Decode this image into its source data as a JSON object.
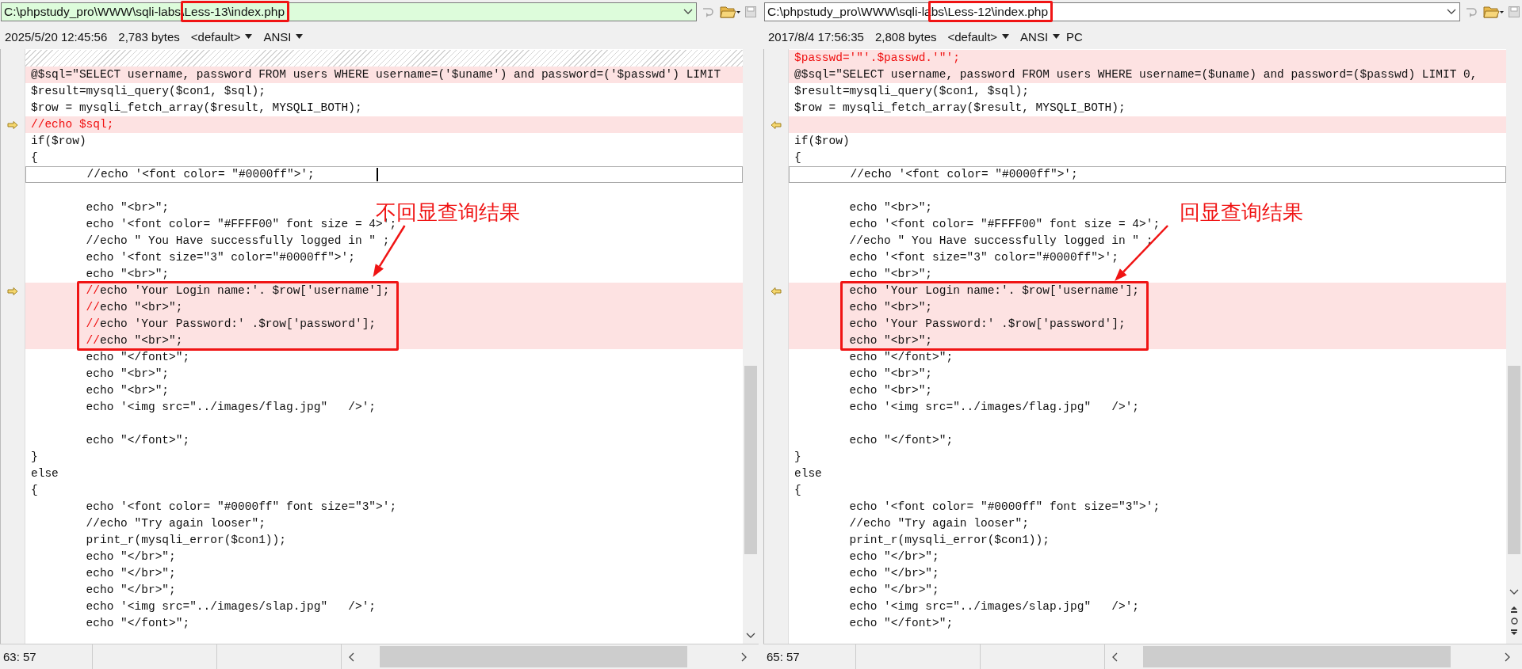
{
  "panes": [
    {
      "kind": "left",
      "active": true,
      "caret": true,
      "nav_buttons": false,
      "path_parts": [
        {
          "text": "C:\\phpstudy_pro\\WWW\\sqli-labs\\",
          "marked": false
        },
        {
          "text": "Less-13\\index.php",
          "marked": true
        }
      ],
      "info": {
        "date": "2025/5/20 12:45:56",
        "size": "2,783 bytes",
        "codepage": "<default>",
        "encoding": "ANSI"
      },
      "annotation": "不回显查询结果",
      "status": "63: 57",
      "lines": [
        {
          "kind": "missing"
        },
        {
          "kind": "diff",
          "text": "@$sql=\"SELECT username, password FROM users WHERE username=('$uname') and password=('$passwd') LIMIT"
        },
        {
          "kind": "normal",
          "text": "$result=mysqli_query($con1, $sql);"
        },
        {
          "kind": "normal",
          "text": "$row = mysqli_fetch_array($result, MYSQLI_BOTH);"
        },
        {
          "kind": "diff-start",
          "segments": [
            {
              "text": "//echo $sql;",
              "changed": true
            }
          ]
        },
        {
          "kind": "normal",
          "text": "if($row)"
        },
        {
          "kind": "normal",
          "text": "{"
        },
        {
          "kind": "normal",
          "text": "        //echo '<font color= \"#0000ff\">';",
          "current": true
        },
        {
          "kind": "normal"
        },
        {
          "kind": "normal",
          "text": "        echo \"<br>\";"
        },
        {
          "kind": "normal",
          "text": "        echo '<font color= \"#FFFF00\" font size = 4>';"
        },
        {
          "kind": "normal",
          "text": "        //echo \" You Have successfully logged in \" ;"
        },
        {
          "kind": "normal",
          "text": "        echo '<font size=\"3\" color=\"#0000ff\">';"
        },
        {
          "kind": "normal",
          "text": "        echo \"<br>\";"
        },
        {
          "kind": "diff-start",
          "segments": [
            {
              "text": "        //",
              "changed": true
            },
            {
              "text": "echo 'Your Login name:'. $row['username'];",
              "changed": false
            }
          ],
          "boxed": true
        },
        {
          "kind": "diff",
          "segments": [
            {
              "text": "        //",
              "changed": true
            },
            {
              "text": "echo \"<br>\";",
              "changed": false
            }
          ],
          "boxed": true
        },
        {
          "kind": "diff",
          "segments": [
            {
              "text": "        //",
              "changed": true
            },
            {
              "text": "echo 'Your Password:' .$row['password'];",
              "changed": false
            }
          ],
          "boxed": true
        },
        {
          "kind": "diff",
          "segments": [
            {
              "text": "        //",
              "changed": true
            },
            {
              "text": "echo \"<br>\";",
              "changed": false
            }
          ],
          "boxed": true
        },
        {
          "kind": "normal",
          "text": "        echo \"</font>\";"
        },
        {
          "kind": "normal",
          "text": "        echo \"<br>\";"
        },
        {
          "kind": "normal",
          "text": "        echo \"<br>\";"
        },
        {
          "kind": "normal",
          "text": "        echo '<img src=\"../images/flag.jpg\"   />';"
        },
        {
          "kind": "normal"
        },
        {
          "kind": "normal",
          "text": "        echo \"</font>\";"
        },
        {
          "kind": "normal",
          "text": "}"
        },
        {
          "kind": "normal",
          "text": "else"
        },
        {
          "kind": "normal",
          "text": "{"
        },
        {
          "kind": "normal",
          "text": "        echo '<font color= \"#0000ff\" font size=\"3\">';"
        },
        {
          "kind": "normal",
          "text": "        //echo \"Try again looser\";"
        },
        {
          "kind": "normal",
          "text": "        print_r(mysqli_error($con1));"
        },
        {
          "kind": "normal",
          "text": "        echo \"</br>\";"
        },
        {
          "kind": "normal",
          "text": "        echo \"</br>\";"
        },
        {
          "kind": "normal",
          "text": "        echo \"</br>\";"
        },
        {
          "kind": "normal",
          "text": "        echo '<img src=\"../images/slap.jpg\"   />';"
        },
        {
          "kind": "normal",
          "text": "        echo \"</font>\";"
        }
      ]
    },
    {
      "kind": "right",
      "active": false,
      "caret": false,
      "nav_buttons": true,
      "path_parts": [
        {
          "text": "C:\\phpstudy_pro\\WWW\\sqli-la",
          "marked": false
        },
        {
          "text": "bs\\Less-12\\index.php",
          "marked": true
        }
      ],
      "info": {
        "date": "2017/8/4 17:56:35",
        "size": "2,808 bytes",
        "codepage": "<default>",
        "encoding": "ANSI",
        "eol": "PC"
      },
      "annotation": "回显查询结果",
      "status": "65: 57",
      "lines": [
        {
          "kind": "diff",
          "segments": [
            {
              "text": "$passwd='\"'.$passwd.'\"';",
              "changed": true
            }
          ]
        },
        {
          "kind": "diff",
          "text": "@$sql=\"SELECT username, password FROM users WHERE username=($uname) and password=($passwd) LIMIT 0,"
        },
        {
          "kind": "normal",
          "text": "$result=mysqli_query($con1, $sql);"
        },
        {
          "kind": "normal",
          "text": "$row = mysqli_fetch_array($result, MYSQLI_BOTH);"
        },
        {
          "kind": "diff-start"
        },
        {
          "kind": "normal",
          "text": "if($row)"
        },
        {
          "kind": "normal",
          "text": "{"
        },
        {
          "kind": "normal",
          "text": "        //echo '<font color= \"#0000ff\">';",
          "current": true
        },
        {
          "kind": "normal"
        },
        {
          "kind": "normal",
          "text": "        echo \"<br>\";"
        },
        {
          "kind": "normal",
          "text": "        echo '<font color= \"#FFFF00\" font size = 4>';"
        },
        {
          "kind": "normal",
          "text": "        //echo \" You Have successfully logged in \" ;"
        },
        {
          "kind": "normal",
          "text": "        echo '<font size=\"3\" color=\"#0000ff\">';"
        },
        {
          "kind": "normal",
          "text": "        echo \"<br>\";"
        },
        {
          "kind": "diff-start",
          "text": "        echo 'Your Login name:'. $row['username'];",
          "boxed": true
        },
        {
          "kind": "diff",
          "text": "        echo \"<br>\";",
          "boxed": true
        },
        {
          "kind": "diff",
          "text": "        echo 'Your Password:' .$row['password'];",
          "boxed": true
        },
        {
          "kind": "diff",
          "text": "        echo \"<br>\";",
          "boxed": true
        },
        {
          "kind": "normal",
          "text": "        echo \"</font>\";"
        },
        {
          "kind": "normal",
          "text": "        echo \"<br>\";"
        },
        {
          "kind": "normal",
          "text": "        echo \"<br>\";"
        },
        {
          "kind": "normal",
          "text": "        echo '<img src=\"../images/flag.jpg\"   />';"
        },
        {
          "kind": "normal"
        },
        {
          "kind": "normal",
          "text": "        echo \"</font>\";"
        },
        {
          "kind": "normal",
          "text": "}"
        },
        {
          "kind": "normal",
          "text": "else"
        },
        {
          "kind": "normal",
          "text": "{"
        },
        {
          "kind": "normal",
          "text": "        echo '<font color= \"#0000ff\" font size=\"3\">';"
        },
        {
          "kind": "normal",
          "text": "        //echo \"Try again looser\";"
        },
        {
          "kind": "normal",
          "text": "        print_r(mysqli_error($con1));"
        },
        {
          "kind": "normal",
          "text": "        echo \"</br>\";"
        },
        {
          "kind": "normal",
          "text": "        echo \"</br>\";"
        },
        {
          "kind": "normal",
          "text": "        echo \"</br>\";"
        },
        {
          "kind": "normal",
          "text": "        echo '<img src=\"../images/slap.jpg\"   />';"
        },
        {
          "kind": "normal",
          "text": "        echo \"</font>\";"
        }
      ]
    }
  ]
}
